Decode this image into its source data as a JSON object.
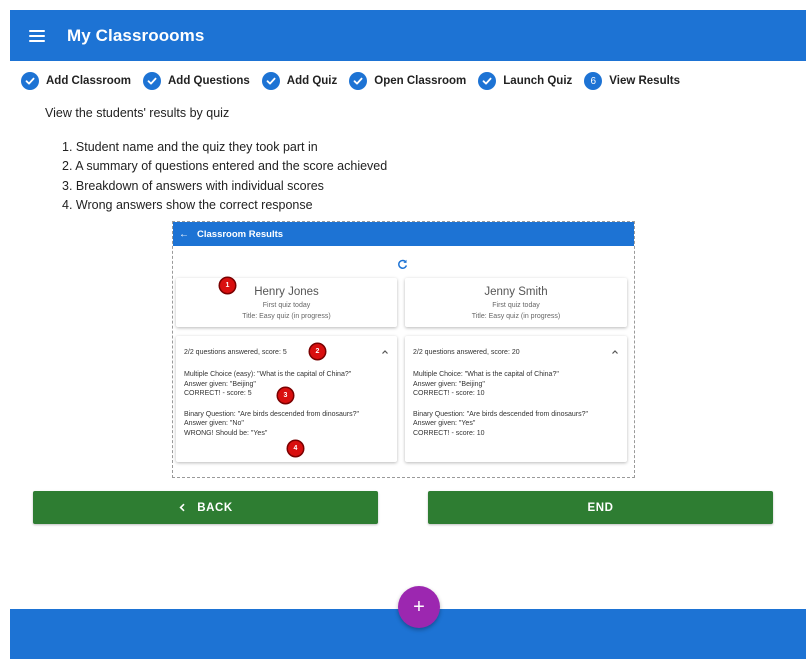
{
  "app": {
    "title": "My Classroooms"
  },
  "stepper": {
    "steps": [
      {
        "label": "Add Classroom",
        "state": "done"
      },
      {
        "label": "Add Questions",
        "state": "done"
      },
      {
        "label": "Add Quiz",
        "state": "done"
      },
      {
        "label": "Open Classroom",
        "state": "done"
      },
      {
        "label": "Launch Quiz",
        "state": "done"
      },
      {
        "label": "View Results",
        "state": "active",
        "number": "6"
      }
    ]
  },
  "intro": "View the students' results by quiz",
  "list": [
    "1. Student name and the quiz they took part in",
    "2. A summary of questions entered and the score achieved",
    "3. Breakdown of answers with individual scores",
    "4. Wrong answers show the correct response"
  ],
  "preview": {
    "title": "Classroom Results",
    "students": [
      {
        "name": "Henry Jones",
        "quiz_time": "First quiz today",
        "quiz_title": "Title: Easy quiz (in progress)",
        "summary": "2/2 questions answered, score: 5",
        "answers": [
          {
            "question": "Multiple Choice (easy): \"What is the capital of China?\"",
            "given": "Answer given: \"Beijing\"",
            "result": "CORRECT! - score: 5"
          },
          {
            "question": "Binary Question: \"Are birds descended from dinosaurs?\"",
            "given": "Answer given: \"No\"",
            "result": "WRONG! Should be: \"Yes\""
          }
        ]
      },
      {
        "name": "Jenny Smith",
        "quiz_time": "First quiz today",
        "quiz_title": "Title: Easy quiz (in progress)",
        "summary": "2/2 questions answered, score: 20",
        "answers": [
          {
            "question": "Multiple Choice: \"What is the capital of China?\"",
            "given": "Answer given: \"Beijing\"",
            "result": "CORRECT! - score: 10"
          },
          {
            "question": "Binary Question: \"Are birds descended from dinosaurs?\"",
            "given": "Answer given: \"Yes\"",
            "result": "CORRECT! - score: 10"
          }
        ]
      }
    ],
    "badges": [
      "1",
      "2",
      "3",
      "4"
    ]
  },
  "buttons": {
    "back": "BACK",
    "end": "END"
  },
  "fab": {
    "icon": "plus-icon",
    "glyph": "+"
  },
  "colors": {
    "primary": "#1d73d4",
    "success": "#2e7d32",
    "accent": "#9c27b0",
    "badge": "#d90f0f"
  }
}
